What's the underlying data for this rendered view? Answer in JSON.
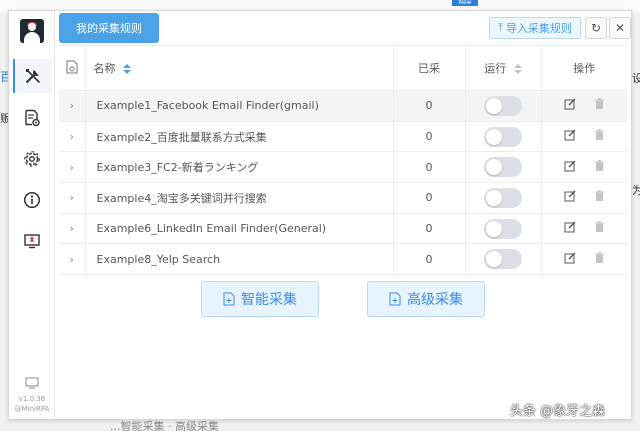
{
  "background": {
    "new_badge": "New",
    "left_char_a": "百",
    "left_char_b": "贩",
    "right_char_a": "设",
    "right_char_b": "为",
    "bottom_text": "...智能采集 · 高级采集"
  },
  "sidebar": {
    "items": [
      {
        "icon": "tools-icon"
      },
      {
        "icon": "document-settings-icon"
      },
      {
        "icon": "gear-icon"
      },
      {
        "icon": "info-icon"
      },
      {
        "icon": "help-monitor-icon"
      }
    ],
    "version": "v1.0.36",
    "brand": "@MiniRPA"
  },
  "header": {
    "tab_label": "我的采集规则",
    "import_label": "导入采集规则"
  },
  "table": {
    "columns": [
      "名称",
      "已采",
      "运行",
      "操作"
    ],
    "rows": [
      {
        "name": "Example1_Facebook Email Finder(gmail)",
        "count": "0"
      },
      {
        "name": "Example2_百度批量联系方式采集",
        "count": "0"
      },
      {
        "name": "Example3_FC2-新着ランキング",
        "count": "0"
      },
      {
        "name": "Example4_淘宝多关键词并行搜索",
        "count": "0"
      },
      {
        "name": "Example6_LinkedIn Email Finder(General)",
        "count": "0"
      },
      {
        "name": "Example8_Yelp Search",
        "count": "0"
      }
    ]
  },
  "actions": {
    "smart_label": "智能采集",
    "advanced_label": "高级采集"
  },
  "watermark": "头条 @象牙之森",
  "colors": {
    "accent": "#4aa3e6",
    "toggle_off": "#dcdfe6"
  }
}
